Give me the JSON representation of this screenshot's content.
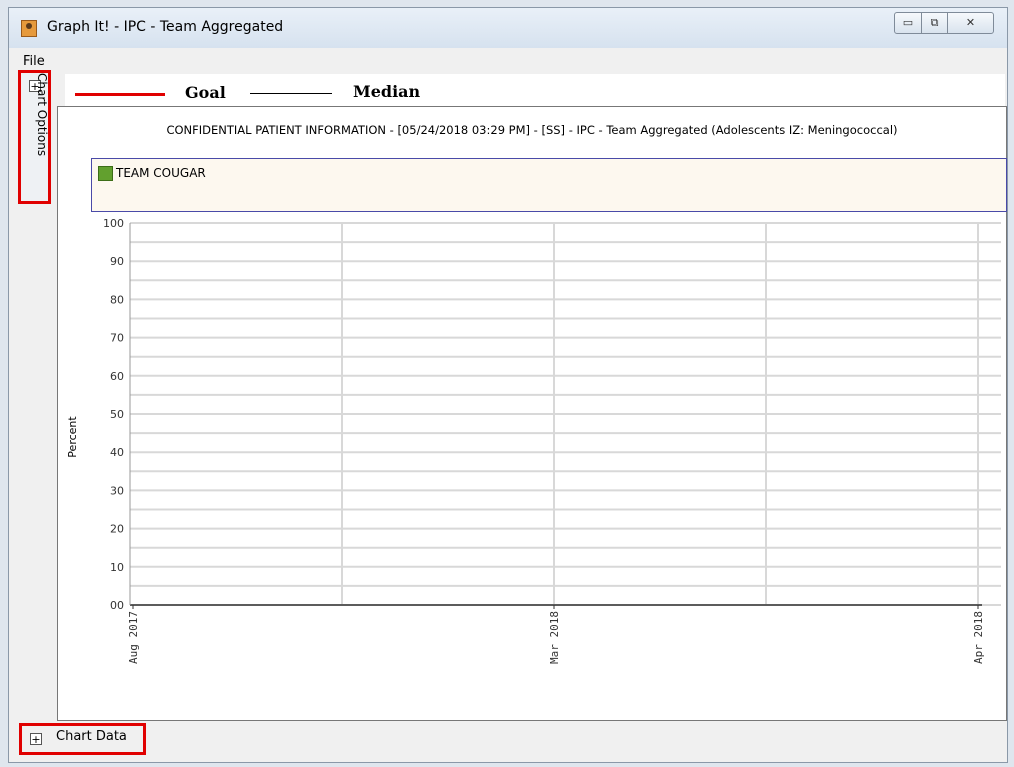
{
  "window": {
    "title": "Graph It! - IPC - Team Aggregated",
    "min_glyph": "▭",
    "max_glyph": "⧉",
    "close_glyph": "✕"
  },
  "menu": {
    "file": "File"
  },
  "legend_strip": {
    "goal": "Goal",
    "median": "Median",
    "goal_color": "#e00000",
    "median_color": "#000000"
  },
  "side_tab": {
    "label": "Chart Options",
    "plus": "+"
  },
  "bottom_tab": {
    "label": "Chart Data",
    "plus": "+"
  },
  "highlight_color": "#e00000",
  "chart_data": {
    "type": "line",
    "title": "CONFIDENTIAL PATIENT INFORMATION - [05/24/2018 03:29 PM] - [SS] - IPC - Team Aggregated (Adolescents IZ: Meningococcal)",
    "ylabel": "Percent",
    "xlabel": "",
    "ylim": [
      0,
      100
    ],
    "yticks": [
      "00",
      "10",
      "20",
      "30",
      "40",
      "50",
      "60",
      "70",
      "80",
      "90",
      "100"
    ],
    "x_tick_labels": [
      "Aug 2017",
      "Mar 2018",
      "Apr 2018"
    ],
    "grid": true,
    "legend_placement": "top",
    "series": [
      {
        "name": "TEAM COUGAR",
        "color": "#62a02e",
        "values": []
      }
    ]
  }
}
